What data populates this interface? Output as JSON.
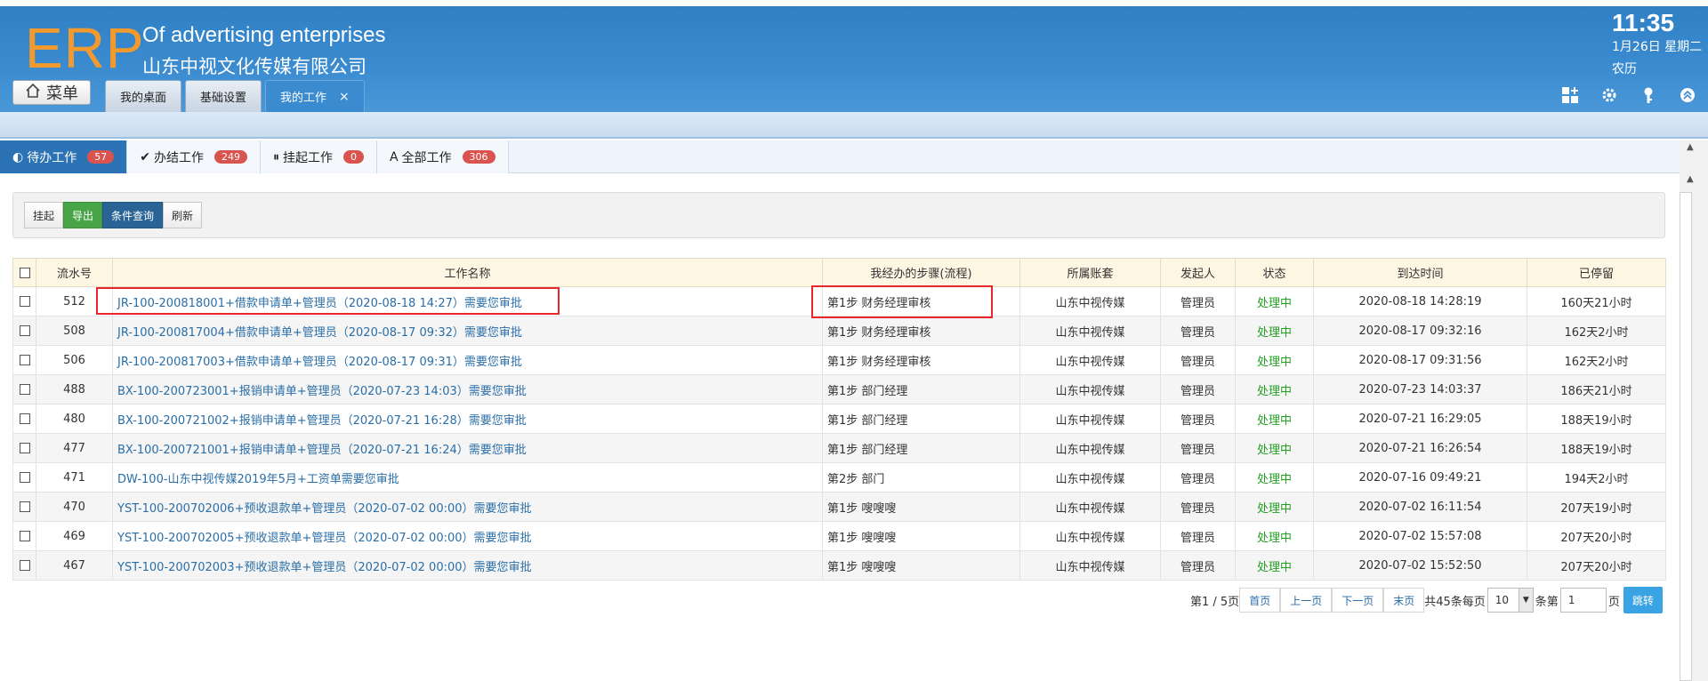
{
  "header": {
    "logo": "ERP",
    "brand_en": "Of advertising enterprises",
    "brand_cn": "山东中视文化传媒有限公司",
    "menu_label": "菜单",
    "tabs": [
      {
        "label": "我的桌面"
      },
      {
        "label": "基础设置"
      },
      {
        "label": "我的工作",
        "close": "×"
      }
    ],
    "clock": "11:35",
    "date": "1月26日 星期二",
    "lunar": "农历"
  },
  "work_tabs": [
    {
      "glyph": "◐",
      "label": "待办工作",
      "count": "57"
    },
    {
      "glyph": "✔",
      "label": "办结工作",
      "count": "249"
    },
    {
      "glyph": "⏸",
      "label": "挂起工作",
      "count": "0"
    },
    {
      "glyph": "A",
      "label": "全部工作",
      "count": "306"
    }
  ],
  "toolbar": {
    "suspend": "挂起",
    "export": "导出",
    "query": "条件查询",
    "refresh": "刷新"
  },
  "table": {
    "columns": [
      "流水号",
      "工作名称",
      "我经办的步骤(流程)",
      "所属账套",
      "发起人",
      "状态",
      "到达时间",
      "已停留"
    ],
    "rows": [
      {
        "id": "512",
        "name": "JR-100-200818001+借款申请单+管理员（2020-08-18 14:27）需要您审批",
        "step": "第1步 财务经理审核",
        "account": "山东中视传媒",
        "initiator": "管理员",
        "status": "处理中",
        "arrival": "2020-08-18 14:28:19",
        "stay": "160天21小时"
      },
      {
        "id": "508",
        "name": "JR-100-200817004+借款申请单+管理员（2020-08-17 09:32）需要您审批",
        "step": "第1步 财务经理审核",
        "account": "山东中视传媒",
        "initiator": "管理员",
        "status": "处理中",
        "arrival": "2020-08-17 09:32:16",
        "stay": "162天2小时"
      },
      {
        "id": "506",
        "name": "JR-100-200817003+借款申请单+管理员（2020-08-17 09:31）需要您审批",
        "step": "第1步 财务经理审核",
        "account": "山东中视传媒",
        "initiator": "管理员",
        "status": "处理中",
        "arrival": "2020-08-17 09:31:56",
        "stay": "162天2小时"
      },
      {
        "id": "488",
        "name": "BX-100-200723001+报销申请单+管理员（2020-07-23 14:03）需要您审批",
        "step": "第1步 部门经理",
        "account": "山东中视传媒",
        "initiator": "管理员",
        "status": "处理中",
        "arrival": "2020-07-23 14:03:37",
        "stay": "186天21小时"
      },
      {
        "id": "480",
        "name": "BX-100-200721002+报销申请单+管理员（2020-07-21 16:28）需要您审批",
        "step": "第1步 部门经理",
        "account": "山东中视传媒",
        "initiator": "管理员",
        "status": "处理中",
        "arrival": "2020-07-21 16:29:05",
        "stay": "188天19小时"
      },
      {
        "id": "477",
        "name": "BX-100-200721001+报销申请单+管理员（2020-07-21 16:24）需要您审批",
        "step": "第1步 部门经理",
        "account": "山东中视传媒",
        "initiator": "管理员",
        "status": "处理中",
        "arrival": "2020-07-21 16:26:54",
        "stay": "188天19小时"
      },
      {
        "id": "471",
        "name": "DW-100-山东中视传媒2019年5月+工资单需要您审批",
        "step": "第2步 部门",
        "account": "山东中视传媒",
        "initiator": "管理员",
        "status": "处理中",
        "arrival": "2020-07-16 09:49:21",
        "stay": "194天2小时"
      },
      {
        "id": "470",
        "name": "YST-100-200702006+预收退款单+管理员（2020-07-02 00:00）需要您审批",
        "step": "第1步 嗖嗖嗖",
        "account": "山东中视传媒",
        "initiator": "管理员",
        "status": "处理中",
        "arrival": "2020-07-02 16:11:54",
        "stay": "207天19小时"
      },
      {
        "id": "469",
        "name": "YST-100-200702005+预收退款单+管理员（2020-07-02 00:00）需要您审批",
        "step": "第1步 嗖嗖嗖",
        "account": "山东中视传媒",
        "initiator": "管理员",
        "status": "处理中",
        "arrival": "2020-07-02 15:57:08",
        "stay": "207天20小时"
      },
      {
        "id": "467",
        "name": "YST-100-200702003+预收退款单+管理员（2020-07-02 00:00）需要您审批",
        "step": "第1步 嗖嗖嗖",
        "account": "山东中视传媒",
        "initiator": "管理员",
        "status": "处理中",
        "arrival": "2020-07-02 15:52:50",
        "stay": "207天20小时"
      }
    ]
  },
  "pager": {
    "page_info": "第1 / 5页",
    "first": "首页",
    "prev": "上一页",
    "next": "下一页",
    "last": "末页",
    "total_text": "共45条每页",
    "page_size": "10",
    "per_suffix": "条第",
    "page_value": "1",
    "page_suffix": "页",
    "go": "跳转"
  },
  "colors": {
    "header_blue": "#3b8bd0",
    "logo_orange": "#f29a2e",
    "status_green": "#23a023",
    "link_blue": "#2a6ea8",
    "highlight_red": "#e8262c"
  }
}
